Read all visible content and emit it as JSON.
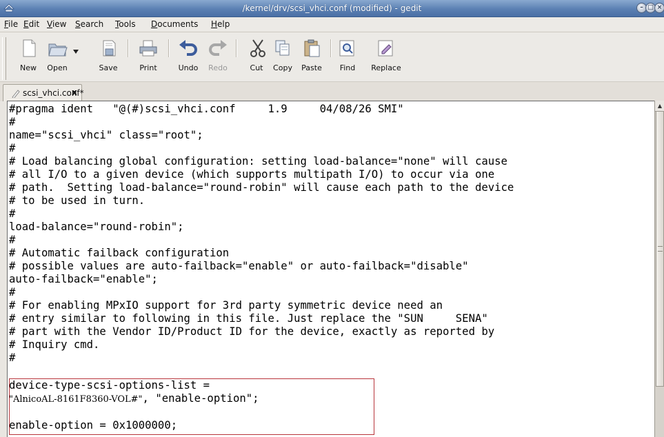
{
  "window": {
    "title": "/kernel/drv/scsi_vhci.conf (modified) - gedit"
  },
  "menubar": {
    "items": [
      {
        "label": "File",
        "mnemonic": "F",
        "rest": "ile"
      },
      {
        "label": "Edit",
        "mnemonic": "E",
        "rest": "dit"
      },
      {
        "label": "View",
        "mnemonic": "V",
        "rest": "iew"
      },
      {
        "label": "Search",
        "mnemonic": "S",
        "rest": "earch"
      },
      {
        "label": "Tools",
        "mnemonic": "T",
        "rest": "ools"
      },
      {
        "label": "Documents",
        "mnemonic": "D",
        "rest": "ocuments"
      },
      {
        "label": "Help",
        "mnemonic": "H",
        "rest": "elp"
      }
    ]
  },
  "toolbar": {
    "new_label": "New",
    "open_label": "Open",
    "save_label": "Save",
    "print_label": "Print",
    "undo_label": "Undo",
    "redo_label": "Redo",
    "cut_label": "Cut",
    "copy_label": "Copy",
    "paste_label": "Paste",
    "find_label": "Find",
    "replace_label": "Replace"
  },
  "tabs": [
    {
      "label": "scsi_vhci.conf*",
      "close_glyph": "x"
    }
  ],
  "editor": {
    "lines": [
      "#pragma ident   \"@(#)scsi_vhci.conf     1.9     04/08/26 SMI\"",
      "#",
      "name=\"scsi_vhci\" class=\"root\";",
      "#",
      "# Load balancing global configuration: setting load-balance=\"none\" will cause",
      "# all I/O to a given device (which supports multipath I/O) to occur via one",
      "# path.  Setting load-balance=\"round-robin\" will cause each path to the device",
      "# to be used in turn.",
      "#",
      "load-balance=\"round-robin\";",
      "#",
      "# Automatic failback configuration",
      "# possible values are auto-failback=\"enable\" or auto-failback=\"disable\"",
      "auto-failback=\"enable\";",
      "#",
      "# For enabling MPxIO support for 3rd party symmetric device need an",
      "# entry similar to following in this file. Just replace the \"SUN     SENA\"",
      "# part with the Vendor ID/Product ID for the device, exactly as reported by",
      "# Inquiry cmd.",
      "#",
      "device-type-scsi-options-list =",
      "",
      "",
      "enable-option = 0x1000000;"
    ],
    "special_line_serif": "\"AlnicoAL-8161F8360-VOL#\"",
    "special_line_mono": ", \"enable-option\";"
  },
  "colors": {
    "titlebar": "#5b80b3",
    "highlight_border": "#b8343a"
  }
}
